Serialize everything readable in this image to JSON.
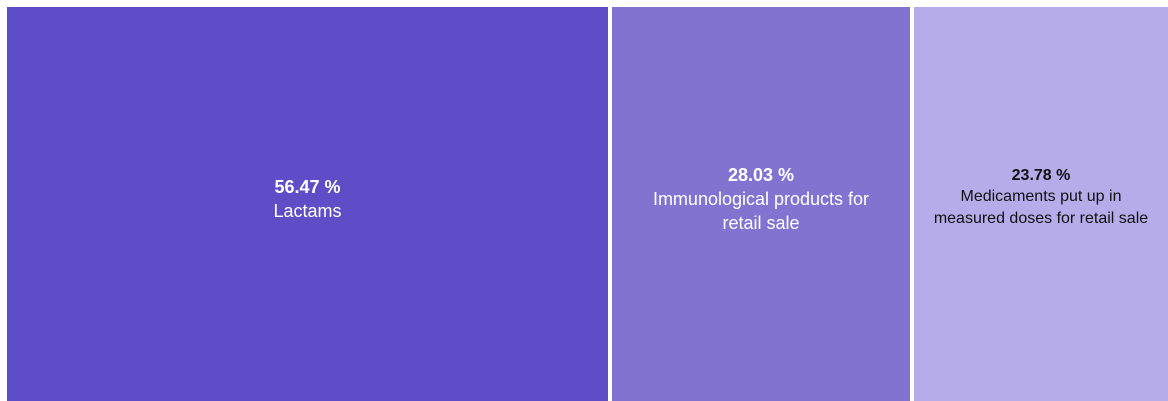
{
  "chart_data": {
    "type": "treemap",
    "items": [
      {
        "value_label": "56.47 %",
        "value": 56.47,
        "label": "Lactams",
        "color": "#5e4dc6",
        "text_color": "#ffffff"
      },
      {
        "value_label": "28.03 %",
        "value": 28.03,
        "label": "Immunological products for retail sale",
        "color": "#8273d1",
        "text_color": "#ffffff"
      },
      {
        "value_label": "23.78 %",
        "value": 23.78,
        "label": "Medicaments put up in measured doses for retail sale",
        "color": "#b6ace9",
        "text_color": "#111111"
      }
    ]
  }
}
